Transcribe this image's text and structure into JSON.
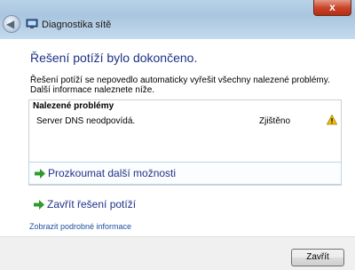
{
  "window": {
    "title": "Diagnostika sítě",
    "close_label": "x"
  },
  "heading": "Řešení potíží bylo dokončeno.",
  "description": "Řešení potíží se nepovedlo automaticky vyřešit všechny nalezené problémy. Další informace naleznete níže.",
  "problems": {
    "header": "Nalezené problémy",
    "items": [
      {
        "text": "Server DNS neodpovídá.",
        "status": "Zjištěno",
        "icon": "warning-icon"
      }
    ]
  },
  "options": [
    {
      "label": "Prozkoumat další možnosti",
      "icon": "green-arrow-icon"
    },
    {
      "label": "Zavřít řešení potíží",
      "icon": "green-arrow-icon"
    }
  ],
  "details_link": "Zobrazit podrobné informace",
  "footer": {
    "close_button": "Zavřít"
  },
  "colors": {
    "heading": "#1e3287",
    "link": "#1e50a0",
    "arrow": "#2e9b2e",
    "warning": "#f2c200"
  }
}
